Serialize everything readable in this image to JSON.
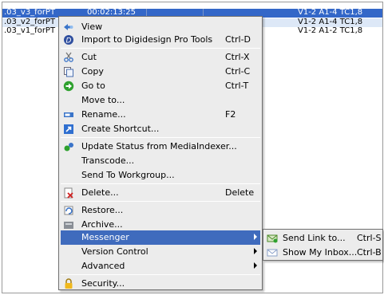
{
  "list": {
    "rows": [
      {
        "name": ".03_v3_forPT",
        "duration": "00:02:13:25",
        "tracks": "V1-2 A1-4 TC1,8"
      },
      {
        "name": ".03_v2_forPT",
        "duration": "",
        "tracks": "V1-2 A1-4 TC1,8"
      },
      {
        "name": ".03_v1_forPT",
        "duration": "",
        "tracks": "V1-2 A1-2 TC1,8"
      }
    ]
  },
  "menu": {
    "view": {
      "label": "View",
      "icon": "view-icon"
    },
    "import_pt": {
      "label": "Import to Digidesign Pro Tools",
      "shortcut": "Ctrl-D",
      "icon": "digidesign-icon"
    },
    "cut": {
      "label": "Cut",
      "shortcut": "Ctrl-X",
      "icon": "scissors-icon"
    },
    "copy": {
      "label": "Copy",
      "shortcut": "Ctrl-C",
      "icon": "copy-icon"
    },
    "goto": {
      "label": "Go to",
      "shortcut": "Ctrl-T",
      "icon": "go-arrow-icon"
    },
    "move_to": {
      "label": "Move to..."
    },
    "rename": {
      "label": "Rename...",
      "shortcut": "F2",
      "icon": "rename-icon"
    },
    "create_shortcut": {
      "label": "Create Shortcut...",
      "icon": "shortcut-icon"
    },
    "update_status": {
      "label": "Update Status from MediaIndexer...",
      "icon": "update-icon"
    },
    "transcode": {
      "label": "Transcode..."
    },
    "send_workgroup": {
      "label": "Send To Workgroup..."
    },
    "delete": {
      "label": "Delete...",
      "shortcut": "Delete",
      "icon": "delete-icon"
    },
    "restore": {
      "label": "Restore...",
      "icon": "restore-icon"
    },
    "archive": {
      "label": "Archive...",
      "icon": "archive-icon"
    },
    "messenger": {
      "label": "Messenger"
    },
    "version_control": {
      "label": "Version Control"
    },
    "advanced": {
      "label": "Advanced"
    },
    "security": {
      "label": "Security...",
      "icon": "lock-icon"
    }
  },
  "submenu": {
    "send_link": {
      "label": "Send Link to...",
      "shortcut": "Ctrl-S",
      "icon": "send-link-icon"
    },
    "show_inbox": {
      "label": "Show My Inbox...",
      "shortcut": "Ctrl-B",
      "icon": "inbox-icon"
    }
  },
  "colors": {
    "highlight": "#3f6bbd",
    "selected_row": "#3367c8",
    "menu_bg": "#ececec"
  }
}
